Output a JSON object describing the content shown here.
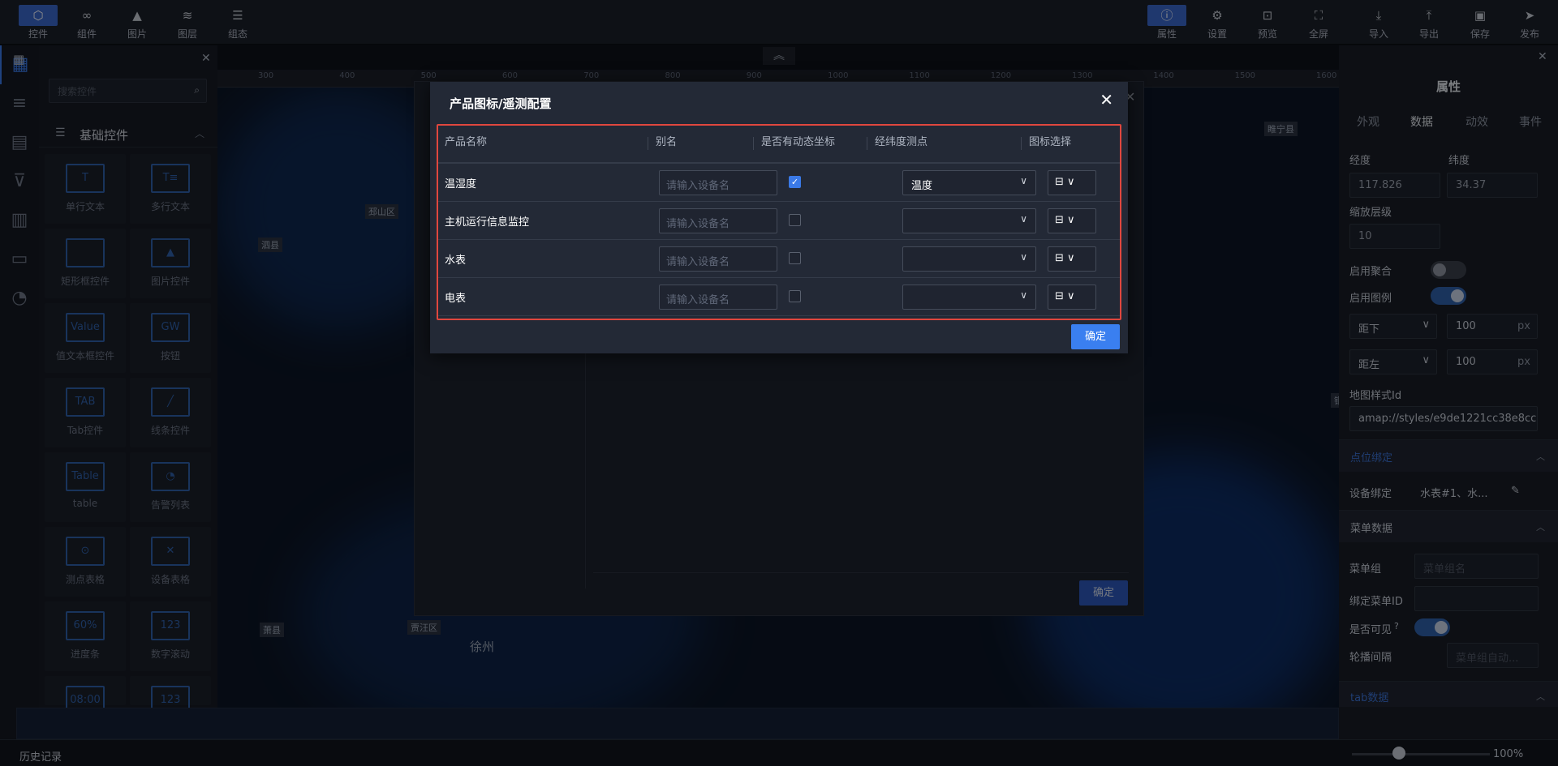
{
  "toolbar": {
    "left": [
      {
        "icon": "cube-icon",
        "label": "控件"
      },
      {
        "icon": "link-icon",
        "label": "组件"
      },
      {
        "icon": "image-icon",
        "label": "图片"
      },
      {
        "icon": "layers-icon",
        "label": "图层"
      },
      {
        "icon": "menu-icon",
        "label": "组态"
      }
    ],
    "right": [
      {
        "icon": "info-icon",
        "label": "属性"
      },
      {
        "icon": "gear-icon",
        "label": "设置"
      },
      {
        "icon": "preview-icon",
        "label": "预览"
      },
      {
        "icon": "fullscreen-icon",
        "label": "全屏"
      },
      {
        "icon": "import-icon",
        "label": "导入"
      },
      {
        "icon": "export-icon",
        "label": "导出"
      },
      {
        "icon": "save-icon",
        "label": "保存"
      },
      {
        "icon": "publish-icon",
        "label": "发布"
      }
    ]
  },
  "left_panel": {
    "search_placeholder": "搜索控件",
    "section_title": "基础控件",
    "components": [
      {
        "preview": "T",
        "label": "单行文本"
      },
      {
        "preview": "T≡",
        "label": "多行文本"
      },
      {
        "preview": "",
        "label": "矩形框控件"
      },
      {
        "preview": "▲",
        "label": "图片控件"
      },
      {
        "preview": "Value",
        "label": "值文本框控件"
      },
      {
        "preview": "GW",
        "label": "按钮"
      },
      {
        "preview": "TAB",
        "label": "Tab控件"
      },
      {
        "preview": "╱",
        "label": "线条控件"
      },
      {
        "preview": "Table",
        "label": "table"
      },
      {
        "preview": "◔",
        "label": "告警列表"
      },
      {
        "preview": "⊙",
        "label": "测点表格"
      },
      {
        "preview": "✕",
        "label": "设备表格"
      },
      {
        "preview": "60%",
        "label": "进度条"
      },
      {
        "preview": "123",
        "label": "数字滚动"
      },
      {
        "preview": "08:00",
        "label": ""
      },
      {
        "preview": "123",
        "label": ""
      }
    ]
  },
  "ruler": [
    "300",
    "400",
    "500",
    "600",
    "700",
    "800",
    "900",
    "1000",
    "1100",
    "1200",
    "1300",
    "1400",
    "1500",
    "1600"
  ],
  "map_labels": [
    "泗县",
    "邳山区",
    "睢宁县",
    "铜山区",
    "贾汪区",
    "徐州",
    "萧县"
  ],
  "bg_dialog": {
    "ok_label": "确定"
  },
  "dialog": {
    "title": "产品图标/遥测配置",
    "columns": [
      "产品名称",
      "别名",
      "是否有动态坐标",
      "经纬度测点",
      "图标选择"
    ],
    "alias_placeholder": "请输入设备名",
    "rows": [
      {
        "name": "温湿度",
        "dynamic": true,
        "point": "温度"
      },
      {
        "name": "主机运行信息监控",
        "dynamic": false,
        "point": ""
      },
      {
        "name": "水表",
        "dynamic": false,
        "point": ""
      },
      {
        "name": "电表",
        "dynamic": false,
        "point": ""
      }
    ],
    "ok_label": "确定"
  },
  "right_panel": {
    "title": "属性",
    "tabs": [
      "外观",
      "数据",
      "动效",
      "事件"
    ],
    "longitude_label": "经度",
    "longitude": "117.826",
    "latitude_label": "纬度",
    "latitude": "34.37",
    "zoom_label": "缩放层级",
    "zoom": "10",
    "cluster_label": "启用聚合",
    "legend_label": "启用图例",
    "bottom_sel": "距下",
    "bottom_val": "100",
    "left_sel": "距左",
    "left_val": "100",
    "unit": "px",
    "style_label": "地图样式Id",
    "style_val": "amap://styles/e9de1221cc38e8cc",
    "section_points": "点位绑定",
    "device_bind_label": "设备绑定",
    "device_bind_val": "水表#1、水...",
    "section_menu": "菜单数据",
    "menu_group_label": "菜单组",
    "menu_group_placeholder": "菜单组名",
    "menu_id_label": "绑定菜单ID",
    "visible_label": "是否可见",
    "interval_label": "轮播间隔",
    "interval_placeholder": "菜单组自动...",
    "section_tab": "tab数据"
  },
  "bottom": {
    "history": "历史记录",
    "zoom": "100%"
  },
  "colors": {
    "accent": "#3a7ff0",
    "highlight": "#e0473e"
  }
}
